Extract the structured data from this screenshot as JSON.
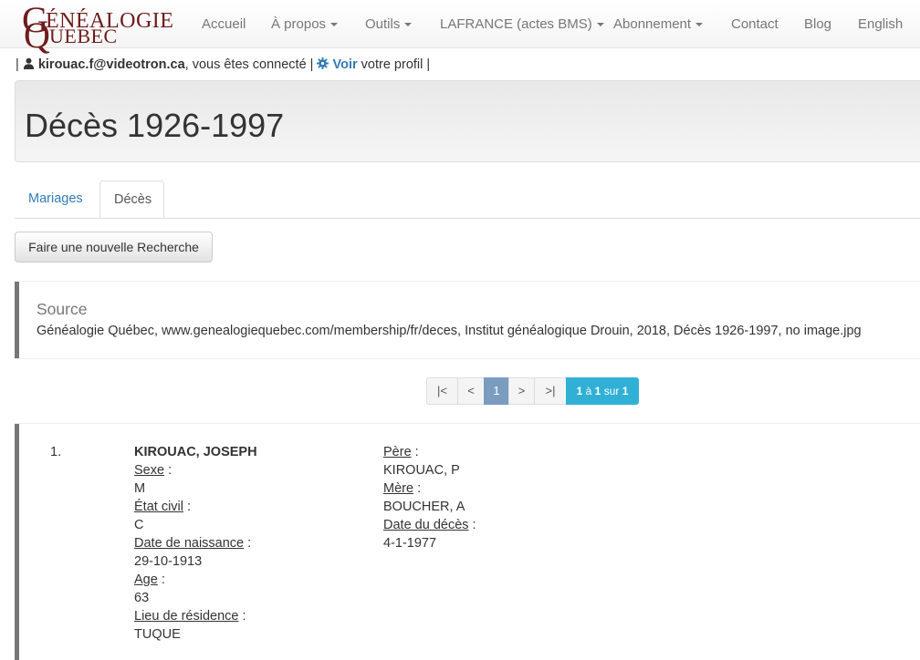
{
  "nav": {
    "logo": {
      "big_g": "G",
      "rest_top": "ÉNÉALOGIE",
      "big_q": "Q",
      "rest_bottom": "UEBEC"
    },
    "items": [
      {
        "label": "Accueil",
        "dropdown": false
      },
      {
        "label": "À propos",
        "dropdown": true
      },
      {
        "label": "Outils",
        "dropdown": true
      },
      {
        "label": "LAFRANCE (actes BMS)",
        "dropdown": true
      },
      {
        "label": "Abonnement",
        "dropdown": true
      },
      {
        "label": "Contact",
        "dropdown": false
      },
      {
        "label": "Blog",
        "dropdown": false
      },
      {
        "label": "English",
        "dropdown": false
      }
    ]
  },
  "user": {
    "sep": "|",
    "email": "kirouac.f@videotron.ca",
    "connected": ", vous êtes connecté",
    "voir": "Voir",
    "profil": "votre profil"
  },
  "page": {
    "title": "Décès 1926-1997"
  },
  "tabs": [
    {
      "label": "Mariages",
      "active": false
    },
    {
      "label": "Décès",
      "active": true
    }
  ],
  "new_search_button": "Faire une nouvelle Recherche",
  "source": {
    "title": "Source",
    "text": "Généalogie Québec, www.genealogiequebec.com/membership/fr/deces, Institut généalogique Drouin, 2018, Décès 1926-1997, no image.jpg"
  },
  "pagination": {
    "first": "|<",
    "prev": "<",
    "current": "1",
    "next": ">",
    "last": ">|",
    "info_from": "1",
    "info_a": "à",
    "info_to": "1",
    "info_sur": "sur",
    "info_total": "1"
  },
  "result": {
    "number": "1.",
    "name": "KIROUAC, JOSEPH",
    "sexe_label": "Sexe",
    "sexe": "M",
    "etat_label": "État civil",
    "etat": "C",
    "naissance_label": "Date de naissance",
    "naissance": "29-10-1913",
    "age_label": "Age",
    "age": "63",
    "residence_label": "Lieu de résidence",
    "residence": "TUQUE",
    "pere_label": "Père",
    "pere": "KIROUAC, P",
    "mere_label": "Mère",
    "mere": "BOUCHER, A",
    "deces_label": "Date du décès",
    "deces": "4-1-1977"
  },
  "colors": {
    "logo": "#6e1c1c",
    "link": "#337ab7",
    "pager_active": "#7a9cbf",
    "pager_info": "#31b0d5"
  },
  "icons": [
    "user-icon",
    "gear-icon",
    "caret-down-icon"
  ]
}
